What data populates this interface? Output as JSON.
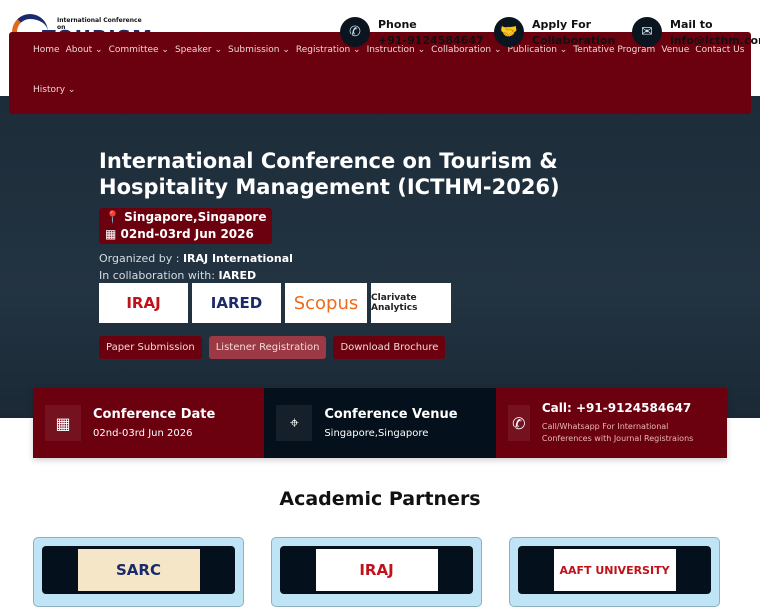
{
  "header": {
    "logo_line1": "International Conference on",
    "logo_line2": "TOURISM",
    "contacts": [
      {
        "icon": "phone-icon",
        "label": "Phone",
        "value": "+91-9124584647"
      },
      {
        "icon": "handshake-icon",
        "label": "Apply For",
        "value": "Collaboration"
      },
      {
        "icon": "envelope-icon",
        "label": "Mail to",
        "value": "info@icthm.com"
      }
    ]
  },
  "nav": [
    {
      "label": "Home",
      "dd": false
    },
    {
      "label": "About",
      "dd": true
    },
    {
      "label": "Committee",
      "dd": true
    },
    {
      "label": "Speaker",
      "dd": true
    },
    {
      "label": "Submission",
      "dd": true
    },
    {
      "label": "Registration",
      "dd": true
    },
    {
      "label": "Instruction",
      "dd": true
    },
    {
      "label": "Collaboration",
      "dd": true
    },
    {
      "label": "Publication",
      "dd": true
    },
    {
      "label": "Tentative Program",
      "dd": false
    },
    {
      "label": "Venue",
      "dd": false
    },
    {
      "label": "Contact Us",
      "dd": false
    },
    {
      "label": "History",
      "dd": true
    }
  ],
  "hero": {
    "title": "International Conference on Tourism & Hospitality Management (ICTHM-2026)",
    "location": "Singapore,Singapore",
    "dates": "02nd-03rd Jun 2026",
    "organized_label": "Organized by : ",
    "organizer": "IRAJ International",
    "collab_label": "In collaboration with: ",
    "collaborator": "IARED",
    "logos": [
      "IRAJ",
      "IARED",
      "Scopus",
      "Clarivate Analytics"
    ],
    "buttons": [
      "Paper Submission",
      "Listener Registration",
      "Download Brochure"
    ]
  },
  "info_cards": [
    {
      "title": "Conference Date",
      "text": "02nd-03rd Jun 2026"
    },
    {
      "title": "Conference Venue",
      "text": "Singapore,Singapore"
    },
    {
      "title": "Call: +91-9124584647",
      "text": "Call/Whatsapp For International Conferences with Journal Registraions"
    }
  ],
  "partners": {
    "heading": "Academic Partners",
    "items": [
      "SARC",
      "IRAJ",
      "AAFT UNIVERSITY"
    ]
  }
}
